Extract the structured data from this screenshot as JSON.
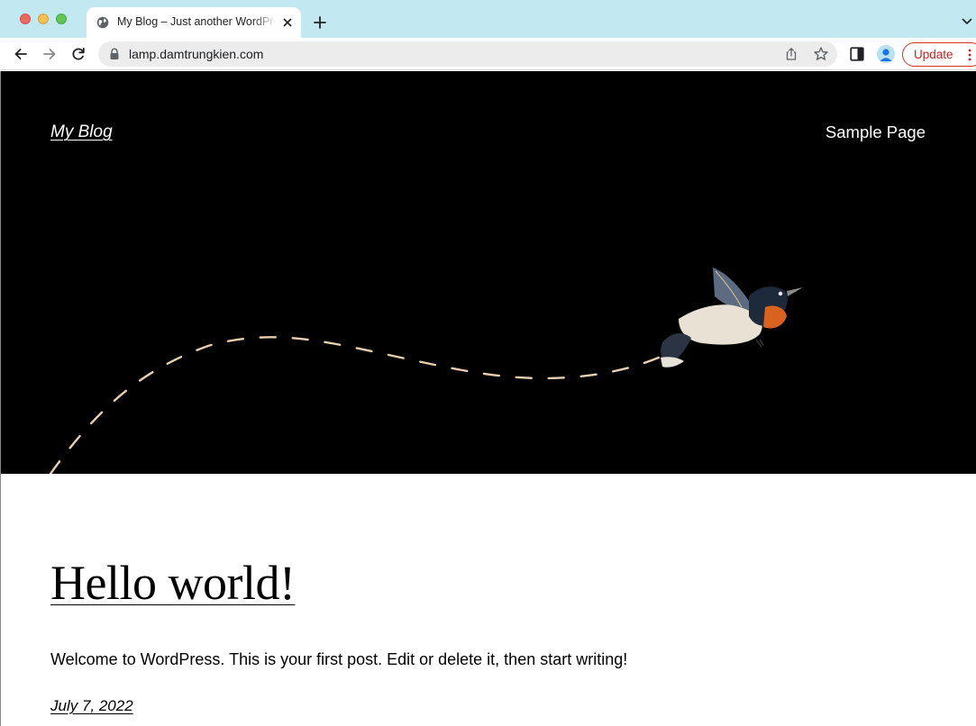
{
  "browser": {
    "tab": {
      "title": "My Blog – Just another WordPress site"
    },
    "url": "lamp.damtrungkien.com",
    "update_label": "Update",
    "colors": {
      "tabstrip": "#c2e8f2",
      "update_accent": "#d93025"
    },
    "icons": [
      "globe-icon",
      "close-icon",
      "plus-icon",
      "chevron-down-icon",
      "back-arrow-icon",
      "forward-arrow-icon",
      "reload-icon",
      "lock-icon",
      "share-icon",
      "star-icon",
      "side-panel-icon",
      "profile-avatar-icon",
      "more-vertical-icon"
    ]
  },
  "site": {
    "title": "My Blog",
    "nav": [
      {
        "label": "Sample Page"
      }
    ],
    "hero_background": "#000000"
  },
  "post": {
    "title": "Hello world!",
    "excerpt": "Welcome to WordPress. This is your first post. Edit or delete it, then start writing!",
    "date": "July 7, 2022"
  }
}
